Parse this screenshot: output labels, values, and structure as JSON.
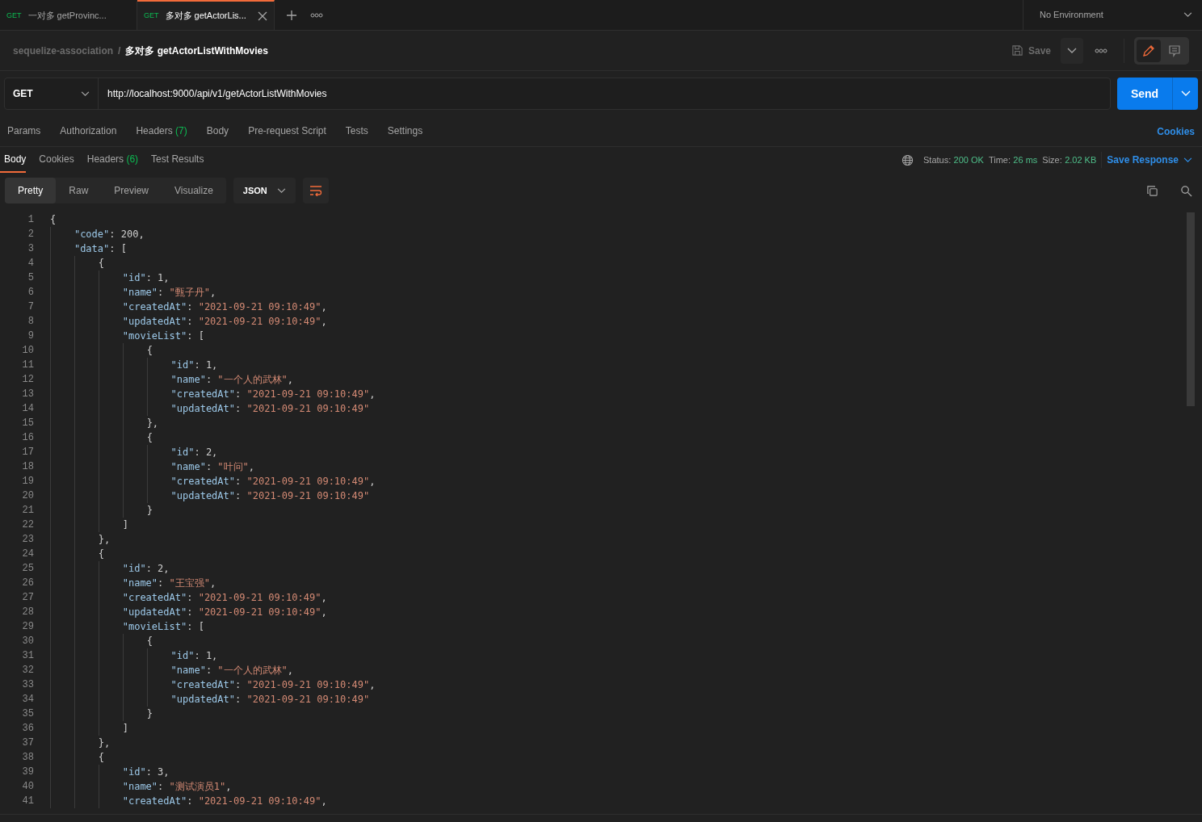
{
  "tabs": [
    {
      "method": "GET",
      "title": "一对多 getProvinc...",
      "selected": false
    },
    {
      "method": "GET",
      "title": "多对多 getActorLis...",
      "selected": true
    }
  ],
  "environment": "No Environment",
  "breadcrumb": {
    "collection": "sequelize-association",
    "separator": "/",
    "request": "多对多 getActorListWithMovies"
  },
  "view_toggle": [
    {
      "kind": "edit",
      "selected": true
    },
    {
      "kind": "comments",
      "selected": false
    }
  ],
  "save_button": {
    "label": "Save",
    "disabled": true
  },
  "request": {
    "method": "GET",
    "url": "http://localhost:9000/api/v1/getActorListWithMovies",
    "send": "Send"
  },
  "request_tabs": [
    {
      "label": "Params",
      "selected": false
    },
    {
      "label": "Authorization",
      "selected": false
    },
    {
      "label": "Headers",
      "count": "(7)",
      "selected": false
    },
    {
      "label": "Body",
      "selected": false
    },
    {
      "label": "Pre-request Script",
      "selected": false
    },
    {
      "label": "Tests",
      "selected": false
    },
    {
      "label": "Settings",
      "selected": false
    }
  ],
  "cookies_link": "Cookies",
  "response_tabs": [
    {
      "label": "Body",
      "selected": true
    },
    {
      "label": "Cookies",
      "selected": false
    },
    {
      "label": "Headers",
      "count": "(6)",
      "selected": false
    },
    {
      "label": "Test Results",
      "selected": false
    }
  ],
  "status": [
    {
      "label": "Status:",
      "value": "200 OK"
    },
    {
      "label": "Time:",
      "value": "26 ms"
    },
    {
      "label": "Size:",
      "value": "2.02 KB"
    }
  ],
  "save_response": "Save Response",
  "view_modes": [
    {
      "label": "Pretty",
      "selected": true
    },
    {
      "label": "Raw",
      "selected": false
    },
    {
      "label": "Preview",
      "selected": false
    },
    {
      "label": "Visualize",
      "selected": false
    }
  ],
  "format": "JSON",
  "code_lines": [
    {
      "number": "1",
      "text": "{"
    },
    {
      "number": "2",
      "text": "    \"code\": 200,"
    },
    {
      "number": "3",
      "text": "    \"data\": ["
    },
    {
      "number": "4",
      "text": "        {"
    },
    {
      "number": "5",
      "text": "            \"id\": 1,"
    },
    {
      "number": "6",
      "text": "            \"name\": \"甄子丹\","
    },
    {
      "number": "7",
      "text": "            \"createdAt\": \"2021-09-21 09:10:49\","
    },
    {
      "number": "8",
      "text": "            \"updatedAt\": \"2021-09-21 09:10:49\","
    },
    {
      "number": "9",
      "text": "            \"movieList\": ["
    },
    {
      "number": "10",
      "text": "                {"
    },
    {
      "number": "11",
      "text": "                    \"id\": 1,"
    },
    {
      "number": "12",
      "text": "                    \"name\": \"一个人的武林\","
    },
    {
      "number": "13",
      "text": "                    \"createdAt\": \"2021-09-21 09:10:49\","
    },
    {
      "number": "14",
      "text": "                    \"updatedAt\": \"2021-09-21 09:10:49\""
    },
    {
      "number": "15",
      "text": "                },"
    },
    {
      "number": "16",
      "text": "                {"
    },
    {
      "number": "17",
      "text": "                    \"id\": 2,"
    },
    {
      "number": "18",
      "text": "                    \"name\": \"叶问\","
    },
    {
      "number": "19",
      "text": "                    \"createdAt\": \"2021-09-21 09:10:49\","
    },
    {
      "number": "20",
      "text": "                    \"updatedAt\": \"2021-09-21 09:10:49\""
    },
    {
      "number": "21",
      "text": "                }"
    },
    {
      "number": "22",
      "text": "            ]"
    },
    {
      "number": "23",
      "text": "        },"
    },
    {
      "number": "24",
      "text": "        {"
    },
    {
      "number": "25",
      "text": "            \"id\": 2,"
    },
    {
      "number": "26",
      "text": "            \"name\": \"王宝强\","
    },
    {
      "number": "27",
      "text": "            \"createdAt\": \"2021-09-21 09:10:49\","
    },
    {
      "number": "28",
      "text": "            \"updatedAt\": \"2021-09-21 09:10:49\","
    },
    {
      "number": "29",
      "text": "            \"movieList\": ["
    },
    {
      "number": "30",
      "text": "                {"
    },
    {
      "number": "31",
      "text": "                    \"id\": 1,"
    },
    {
      "number": "32",
      "text": "                    \"name\": \"一个人的武林\","
    },
    {
      "number": "33",
      "text": "                    \"createdAt\": \"2021-09-21 09:10:49\","
    },
    {
      "number": "34",
      "text": "                    \"updatedAt\": \"2021-09-21 09:10:49\""
    },
    {
      "number": "35",
      "text": "                }"
    },
    {
      "number": "36",
      "text": "            ]"
    },
    {
      "number": "37",
      "text": "        },"
    },
    {
      "number": "38",
      "text": "        {"
    },
    {
      "number": "39",
      "text": "            \"id\": 3,"
    },
    {
      "number": "40",
      "text": "            \"name\": \"测试演员1\","
    },
    {
      "number": "41",
      "text": "            \"createdAt\": \"2021-09-21 09:10:49\","
    }
  ]
}
